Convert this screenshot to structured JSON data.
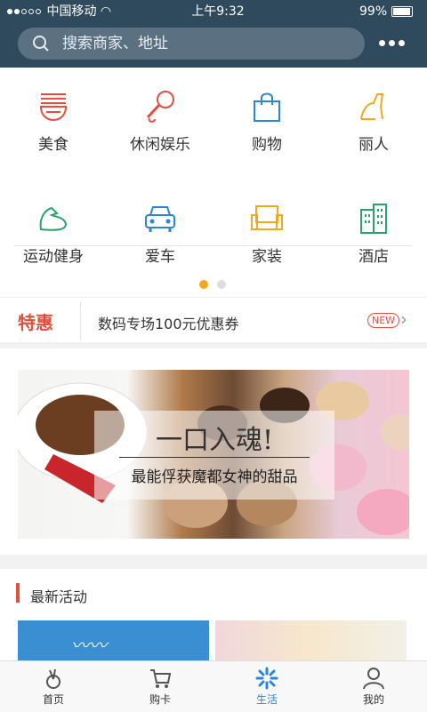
{
  "status_bar": {
    "carrier": "中国移动",
    "time": "上午9:32",
    "battery": "99%"
  },
  "header": {
    "search_placeholder": "搜索商家、地址",
    "more_icon": "more-dots-icon"
  },
  "categories": [
    {
      "label": "美食",
      "icon": "noodle-bowl-icon",
      "color": "#e84c3d"
    },
    {
      "label": "休闲娱乐",
      "icon": "microphone-icon",
      "color": "#e84c3d"
    },
    {
      "label": "购物",
      "icon": "shopping-bag-icon",
      "color": "#2a86d9"
    },
    {
      "label": "丽人",
      "icon": "high-heel-icon",
      "color": "#f3a81c"
    },
    {
      "label": "运动健身",
      "icon": "arm-muscle-icon",
      "color": "#2aa36b"
    },
    {
      "label": "爱车",
      "icon": "car-icon",
      "color": "#2a86d9"
    },
    {
      "label": "家装",
      "icon": "sofa-icon",
      "color": "#f3a81c"
    },
    {
      "label": "酒店",
      "icon": "hotel-building-icon",
      "color": "#2aa36b"
    }
  ],
  "pager": {
    "active_color": "#f3a81c",
    "inactive_color": "#dddddd"
  },
  "promo": {
    "tag": "特惠",
    "text": "数码专场100元优惠券",
    "badge": "NEW"
  },
  "banner": {
    "title": "一口入魂!",
    "subtitle": "最能俘获魔都女神的甜品"
  },
  "latest": {
    "title": "最新活动"
  },
  "tabbar": {
    "tabs": [
      {
        "label": "首页",
        "icon": "home-icon",
        "active": false
      },
      {
        "label": "购卡",
        "icon": "cart-icon",
        "active": false
      },
      {
        "label": "生活",
        "icon": "life-pinwheel-icon",
        "active": true
      },
      {
        "label": "我的",
        "icon": "user-icon",
        "active": false
      }
    ]
  },
  "colors": {
    "header_bg": "#2f4a5c",
    "accent_red": "#e84c3d",
    "accent_blue": "#2a86d9"
  }
}
